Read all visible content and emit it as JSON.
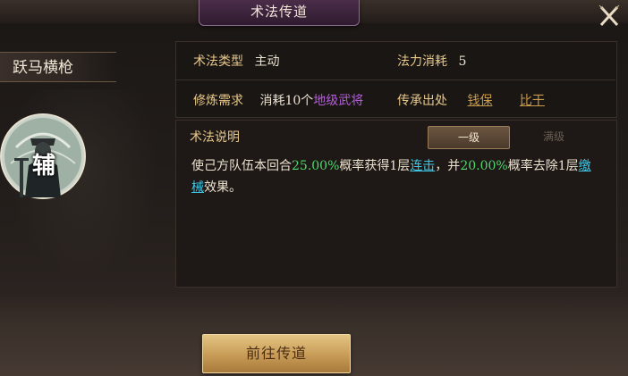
{
  "window": {
    "title": "术法传道"
  },
  "general": {
    "name": "跃马横枪",
    "role_char": "辅"
  },
  "info": {
    "type_label": "术法类型",
    "type_value": "主动",
    "cost_label": "法力消耗",
    "cost_value": "5",
    "req_label": "修炼需求",
    "req_prefix": "消耗10个",
    "req_highlight": "地级武将",
    "source_label": "传承出处",
    "source_1": "钱保",
    "source_2": "比干"
  },
  "description": {
    "title": "术法说明",
    "tab_level1": "一级",
    "tab_max": "满级",
    "text_1": "使己方队伍本回合",
    "pct_1": "25.00%",
    "text_2": "概率获得1层",
    "keyword_1": "连击",
    "text_3": "，并",
    "pct_2": "20.00%",
    "text_4": "概率去除1层",
    "keyword_2": "缴械",
    "text_5": "效果。"
  },
  "actions": {
    "go_button": "前往传道"
  },
  "colors": {
    "label_gold": "#e8c88a",
    "value_green": "#4fd66d",
    "keyword_cyan": "#3ec6e6",
    "rank_purple": "#b35dd9",
    "title_bar": "#4b2d4a",
    "button_gold": "#c79b56"
  },
  "icons": {
    "close": "close-x-icon",
    "portrait": "general-portrait-icon"
  }
}
